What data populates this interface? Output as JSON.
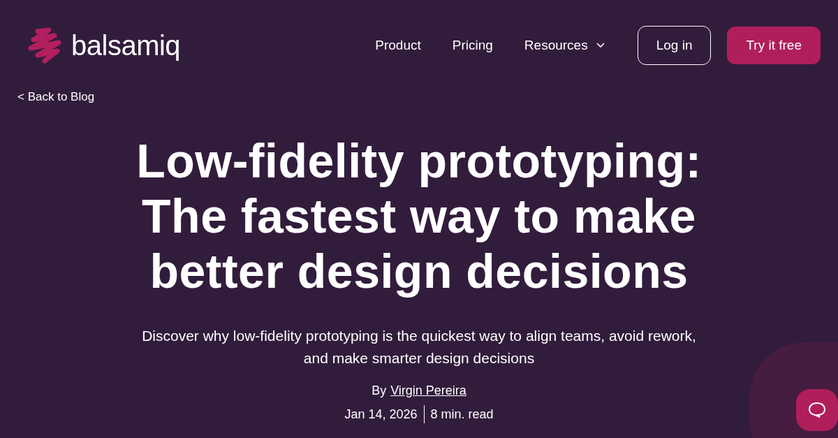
{
  "logo": {
    "text": "balsamiq"
  },
  "nav": {
    "items": [
      {
        "label": "Product",
        "dropdown": false
      },
      {
        "label": "Pricing",
        "dropdown": false
      },
      {
        "label": "Resources",
        "dropdown": true
      }
    ],
    "login": "Log in",
    "cta": "Try it free"
  },
  "back_link": "< Back to Blog",
  "article": {
    "title_lines": [
      "Low-fidelity prototyping:",
      "The fastest way to make",
      "better design decisions"
    ],
    "subtitle_lines": [
      "Discover why low-fidelity prototyping is the quickest way to align teams, avoid rework,",
      "and make smarter design decisions"
    ],
    "by": "By",
    "author": "Virgin Pereira",
    "date": "Jan 14, 2026",
    "read_time": "8 min. read"
  }
}
